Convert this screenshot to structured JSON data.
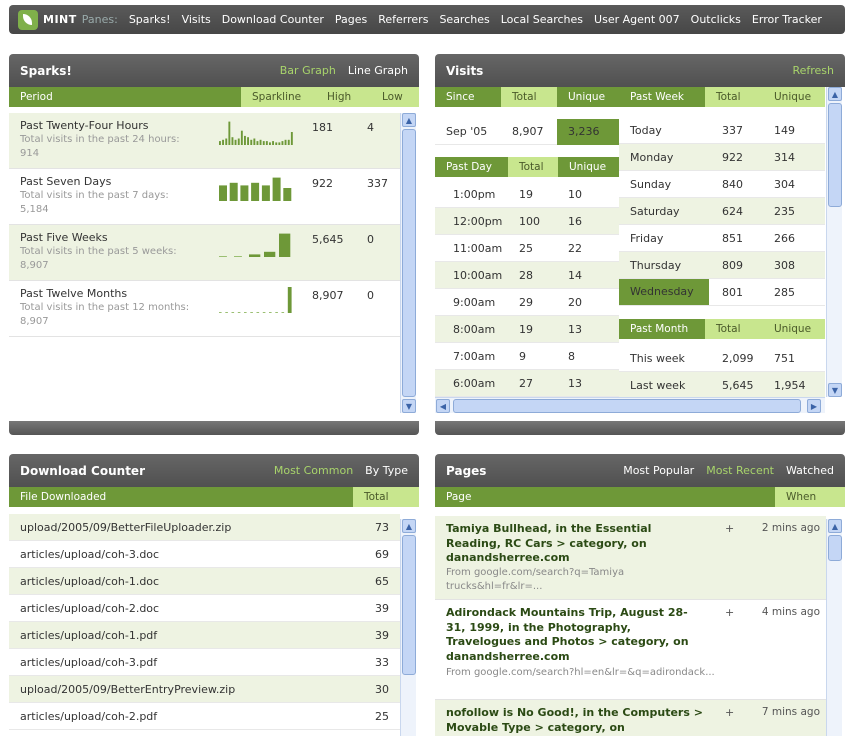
{
  "nav": {
    "logo": "MINT",
    "panes_label": "Panes:",
    "links": [
      "Sparks!",
      "Visits",
      "Download Counter",
      "Pages",
      "Referrers",
      "Searches",
      "Local Searches",
      "User Agent 007",
      "Outclicks",
      "Error Tracker"
    ]
  },
  "colors": {
    "accent": "#6e9838",
    "highlight": "#c8e68e",
    "link_active": "#a8d46b",
    "header": "#555555"
  },
  "sparks": {
    "title": "Sparks!",
    "tabs": [
      "Bar Graph",
      "Line Graph"
    ],
    "active_tab": 0,
    "columns": [
      "Period",
      "Sparkline",
      "High",
      "Low"
    ],
    "rows": [
      {
        "period": "Past Twenty-Four Hours",
        "desc": "Total visits in the past 24 hours: 914",
        "high": "181",
        "low": "4",
        "spark": [
          0.15,
          0.2,
          0.25,
          0.9,
          0.3,
          0.2,
          0.25,
          0.55,
          0.35,
          0.3,
          0.2,
          0.25,
          0.15,
          0.2,
          0.15,
          0.15,
          0.1,
          0.15,
          0.1,
          0.1,
          0.15,
          0.2,
          0.2,
          0.5
        ]
      },
      {
        "period": "Past Seven Days",
        "desc": "Total visits in the past 7 days: 5,184",
        "high": "922",
        "low": "337",
        "spark": [
          0.6,
          0.7,
          0.6,
          0.7,
          0.6,
          0.9,
          0.5
        ]
      },
      {
        "period": "Past Five Weeks",
        "desc": "Total visits in the past 5 weeks: 8,907",
        "high": "5,645",
        "low": "0",
        "spark": [
          0,
          0,
          0.1,
          0.2,
          0.9
        ]
      },
      {
        "period": "Past Twelve Months",
        "desc": "Total visits in the past 12 months: 8,907",
        "high": "8,907",
        "low": "0",
        "spark": [
          0,
          0,
          0,
          0,
          0,
          0,
          0,
          0,
          0,
          0,
          0,
          1
        ]
      }
    ]
  },
  "visits": {
    "title": "Visits",
    "refresh": "Refresh",
    "since_cols": [
      "Since",
      "Total",
      "Unique"
    ],
    "since_row": [
      "Sep '05",
      "8,907",
      "3,236"
    ],
    "day_cols": [
      "Past Day",
      "Total",
      "Unique"
    ],
    "day_rows": [
      [
        "1:00pm",
        "19",
        "10"
      ],
      [
        "12:00pm",
        "100",
        "16"
      ],
      [
        "11:00am",
        "25",
        "22"
      ],
      [
        "10:00am",
        "28",
        "14"
      ],
      [
        "9:00am",
        "29",
        "20"
      ],
      [
        "8:00am",
        "19",
        "13"
      ],
      [
        "7:00am",
        "9",
        "8"
      ],
      [
        "6:00am",
        "27",
        "13"
      ]
    ],
    "week_cols": [
      "Past Week",
      "Total",
      "Unique"
    ],
    "week_rows": [
      [
        "Today",
        "337",
        "149"
      ],
      [
        "Monday",
        "922",
        "314"
      ],
      [
        "Sunday",
        "840",
        "304"
      ],
      [
        "Saturday",
        "624",
        "235"
      ],
      [
        "Friday",
        "851",
        "266"
      ],
      [
        "Thursday",
        "809",
        "308"
      ],
      [
        "Wednesday",
        "801",
        "285"
      ]
    ],
    "month_cols": [
      "Past Month",
      "Total",
      "Unique"
    ],
    "month_rows": [
      [
        "This week",
        "2,099",
        "751"
      ],
      [
        "Last week",
        "5,645",
        "1,954"
      ]
    ]
  },
  "downloads": {
    "title": "Download Counter",
    "tabs": [
      "Most Common",
      "By Type"
    ],
    "active_tab": 0,
    "columns": [
      "File Downloaded",
      "Total"
    ],
    "rows": [
      [
        "upload/2005/09/BetterFileUploader.zip",
        "73"
      ],
      [
        "articles/upload/coh-3.doc",
        "69"
      ],
      [
        "articles/upload/coh-1.doc",
        "65"
      ],
      [
        "articles/upload/coh-2.doc",
        "39"
      ],
      [
        "articles/upload/coh-1.pdf",
        "39"
      ],
      [
        "articles/upload/coh-3.pdf",
        "33"
      ],
      [
        "upload/2005/09/BetterEntryPreview.zip",
        "30"
      ],
      [
        "articles/upload/coh-2.pdf",
        "25"
      ]
    ]
  },
  "pages": {
    "title": "Pages",
    "tabs": [
      "Most Popular",
      "Most Recent",
      "Watched"
    ],
    "active_tab": 1,
    "columns": [
      "Page",
      "When"
    ],
    "rows": [
      {
        "title": "Tamiya Bullhead, in the Essential Reading, RC Cars > category, on danandsherree.com",
        "from": "From google.com/search?q=Tamiya trucks&hl=fr&lr=...",
        "plus": "+",
        "when": "2 mins ago"
      },
      {
        "title": "Adirondack Mountains Trip, August 28-31, 1999, in the Photography, Travelogues and Photos > category, on danandsherree.com",
        "from": "From google.com/search?hl=en&lr=&q=adirondack...",
        "plus": "+",
        "when": "4 mins ago"
      },
      {
        "title": "nofollow is No Good!, in the Computers > Movable Type > category, on",
        "from": "",
        "plus": "+",
        "when": "7 mins ago"
      }
    ]
  }
}
